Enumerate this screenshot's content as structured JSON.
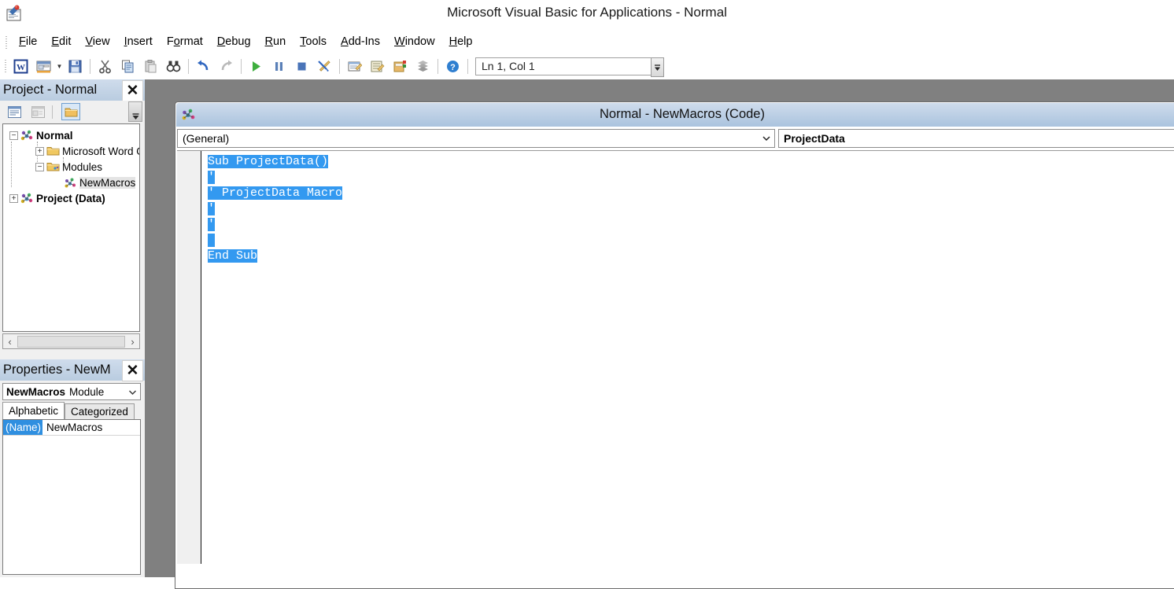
{
  "window": {
    "title": "Microsoft Visual Basic for Applications - Normal",
    "app_icon": "vba-app-icon"
  },
  "menubar": {
    "items": [
      {
        "label": "File",
        "accel": "F"
      },
      {
        "label": "Edit",
        "accel": "E"
      },
      {
        "label": "View",
        "accel": "V"
      },
      {
        "label": "Insert",
        "accel": "I"
      },
      {
        "label": "Format",
        "accel": "o"
      },
      {
        "label": "Debug",
        "accel": "D"
      },
      {
        "label": "Run",
        "accel": "R"
      },
      {
        "label": "Tools",
        "accel": "T"
      },
      {
        "label": "Add-Ins",
        "accel": "A"
      },
      {
        "label": "Window",
        "accel": "W"
      },
      {
        "label": "Help",
        "accel": "H"
      }
    ]
  },
  "toolbar": {
    "buttons": [
      {
        "name": "view-word-button",
        "icon": "word-w-icon"
      },
      {
        "name": "insert-userform-button",
        "icon": "userform-icon"
      },
      {
        "name": "insert-dropdown-arrow",
        "icon": "chevron-down-icon"
      },
      {
        "name": "save-button",
        "icon": "floppy-disk-icon"
      },
      {
        "name": "cut-button",
        "icon": "scissors-icon"
      },
      {
        "name": "copy-button",
        "icon": "copy-icon"
      },
      {
        "name": "paste-button",
        "icon": "paste-icon"
      },
      {
        "name": "find-button",
        "icon": "binoculars-icon"
      },
      {
        "name": "undo-button",
        "icon": "undo-arrow-icon"
      },
      {
        "name": "redo-button",
        "icon": "redo-arrow-icon"
      },
      {
        "name": "run-button",
        "icon": "play-triangle-icon"
      },
      {
        "name": "break-button",
        "icon": "pause-bars-icon"
      },
      {
        "name": "reset-button",
        "icon": "stop-square-icon"
      },
      {
        "name": "design-mode-button",
        "icon": "design-ruler-pencil-icon"
      },
      {
        "name": "project-explorer-button",
        "icon": "project-explorer-icon"
      },
      {
        "name": "properties-window-button",
        "icon": "properties-window-icon"
      },
      {
        "name": "object-browser-button",
        "icon": "object-browser-icon"
      },
      {
        "name": "toolbox-button",
        "icon": "toolbox-icon"
      },
      {
        "name": "help-button",
        "icon": "help-question-icon"
      }
    ],
    "position_indicator": "Ln 1, Col 1"
  },
  "project_explorer": {
    "caption": "Project - Normal",
    "close_label": "✕",
    "toolbar_buttons": [
      {
        "name": "view-code-button",
        "icon": "view-code-icon",
        "active": false
      },
      {
        "name": "view-object-button",
        "icon": "view-object-icon",
        "active": false
      },
      {
        "name": "toggle-folders-button",
        "icon": "folder-icon",
        "active": true
      }
    ],
    "tree": [
      {
        "label": "Normal",
        "icon": "vba-project-icon",
        "expander": "−",
        "bold": true,
        "indent": 0,
        "selected": false
      },
      {
        "label": "Microsoft Word Ol",
        "icon": "folder-closed-icon",
        "expander": "+",
        "bold": false,
        "indent": 1,
        "selected": false
      },
      {
        "label": "Modules",
        "icon": "folder-modules-icon",
        "expander": "−",
        "bold": false,
        "indent": 1,
        "selected": false
      },
      {
        "label": "NewMacros",
        "icon": "module-icon",
        "expander": "",
        "bold": false,
        "indent": 2,
        "selected": true
      },
      {
        "label": "Project (Data)",
        "icon": "vba-project-icon",
        "expander": "+",
        "bold": true,
        "indent": 0,
        "selected": false
      }
    ],
    "hscroll": {
      "left_arrow": "‹",
      "right_arrow": "›"
    }
  },
  "properties_window": {
    "caption": "Properties - NewM",
    "close_label": "✕",
    "object_name": "NewMacros",
    "object_type": "Module",
    "tabs": [
      {
        "label": "Alphabetic",
        "active": true
      },
      {
        "label": "Categorized",
        "active": false
      }
    ],
    "rows": [
      {
        "key": "(Name)",
        "value": "NewMacros"
      }
    ]
  },
  "code_window": {
    "title": "Normal - NewMacros (Code)",
    "icon": "module-icon",
    "object_dropdown": {
      "value": "(General)",
      "bold": false
    },
    "procedure_dropdown": {
      "value": "ProjectData",
      "bold": true
    },
    "code_lines": [
      {
        "text": "Sub ProjectData()",
        "selected": true,
        "sel_chars": 17,
        "comment": false
      },
      {
        "text": "'",
        "selected": true,
        "sel_chars": 1,
        "comment": true
      },
      {
        "text": "' ProjectData Macro",
        "selected": true,
        "sel_chars": 19,
        "comment": true
      },
      {
        "text": "'",
        "selected": true,
        "sel_chars": 1,
        "comment": true
      },
      {
        "text": "'",
        "selected": true,
        "sel_chars": 1,
        "comment": true
      },
      {
        "text": "",
        "selected": true,
        "sel_chars": 1,
        "comment": false
      },
      {
        "text": "End Sub",
        "selected": true,
        "sel_chars": 7,
        "comment": false
      }
    ]
  },
  "colors": {
    "selection_blue": "#3399f0",
    "caption_gradient_top": "#cfdcec",
    "caption_gradient_bottom": "#aac3de",
    "mdi_background": "#808080",
    "panel_background": "#f0f0f0"
  }
}
